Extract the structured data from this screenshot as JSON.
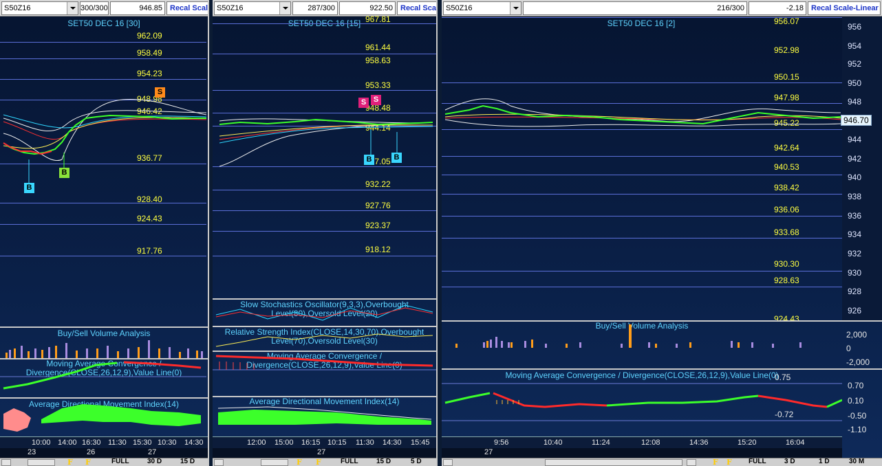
{
  "panes": [
    {
      "symbol": "S50Z16",
      "bars": "300/300",
      "price": "946.85",
      "recal": "Recal Scale",
      "title": "SET50 DEC 16   [30]",
      "levels": [
        "962.09",
        "958.49",
        "954.23",
        "948.98",
        "946.42",
        "936.77",
        "928.40",
        "924.43",
        "917.76"
      ],
      "markers": [
        "S",
        "B",
        "B"
      ],
      "ind_volume": "Buy/Sell Volume Analysis",
      "ind_macd": "Moving Average Convergence / Divergence(CLOSE,26,12,9),Value Line(0)",
      "ind_adx": "Average Directional Movement Index(14)",
      "times": [
        "10:00",
        "14:00",
        "16:30",
        "11:30",
        "15:30",
        "10:30",
        "14:30"
      ],
      "dates": [
        "23",
        "26",
        "27"
      ],
      "bottom": [
        "FULL",
        "30 D",
        "15 D"
      ]
    },
    {
      "symbol": "S50Z16",
      "bars": "287/300",
      "price": "922.50",
      "recal": "Recal Scale",
      "title": "SET50 DEC 16   [15]",
      "levels": [
        "967.81",
        "961.44",
        "958.63",
        "953.33",
        "948.48",
        "944.14",
        "937.05",
        "932.22",
        "927.76",
        "923.37",
        "918.12"
      ],
      "markers": [
        "S",
        "S",
        "B",
        "B"
      ],
      "ind_stoch": "Slow Stochastics Oscillator(9,3,3),Overbought Level(80),Oversold Level(20)",
      "ind_rsi": "Relative Strength Index(CLOSE,14,30,70),Overbought Level(70),Oversold Level(30)",
      "ind_macd": "Moving Average Convergence / Divergence(CLOSE,26,12,9),Value Line(0)",
      "ind_adx": "Average Directional Movement Index(14)",
      "times": [
        "12:00",
        "15:00",
        "16:15",
        "10:15",
        "11:30",
        "14:30",
        "15:45"
      ],
      "dates": [
        "27"
      ],
      "bottom": [
        "FULL",
        "15 D",
        "5 D"
      ]
    },
    {
      "symbol": "S50Z16",
      "bars": "216/300",
      "price": "-2.18",
      "recal": "Recal Scale-Linear",
      "title": "SET50 DEC 16   [2]",
      "last": "946.70",
      "levels": [
        "956.07",
        "952.98",
        "950.15",
        "947.98",
        "945.22",
        "942.64",
        "940.53",
        "938.42",
        "936.06",
        "933.68",
        "930.30",
        "928.63",
        "924.43"
      ],
      "yticks": [
        "956",
        "954",
        "952",
        "950",
        "948",
        "946",
        "944",
        "942",
        "940",
        "938",
        "936",
        "934",
        "932",
        "930",
        "928",
        "926"
      ],
      "ind_volume": "Buy/Sell Volume Analysis",
      "vol_ticks": [
        "2,000",
        "0",
        "-2,000"
      ],
      "ind_macd": "Moving Average Convergence / Divergence(CLOSE,26,12,9),Value Line(0)",
      "macd_vals": [
        "0.75",
        "-0.72"
      ],
      "macd_ticks": [
        "0.70",
        "0.10",
        "-0.50",
        "-1.10"
      ],
      "times": [
        "9:56",
        "10:40",
        "11:24",
        "12:08",
        "14:36",
        "15:20",
        "16:04"
      ],
      "dates": [
        "27"
      ],
      "bottom": [
        "FULL",
        "3 D",
        "1 D",
        "30 M"
      ]
    }
  ],
  "colors": {
    "level_text": "#ffff40",
    "title_text": "#5fd4ff",
    "buy_marker": "#3ad7ff",
    "sell_marker": "#ff8a1a",
    "sell_marker2": "#e0207a",
    "up_bar": "#3cff2a",
    "down_bar": "#ff2a2a"
  }
}
